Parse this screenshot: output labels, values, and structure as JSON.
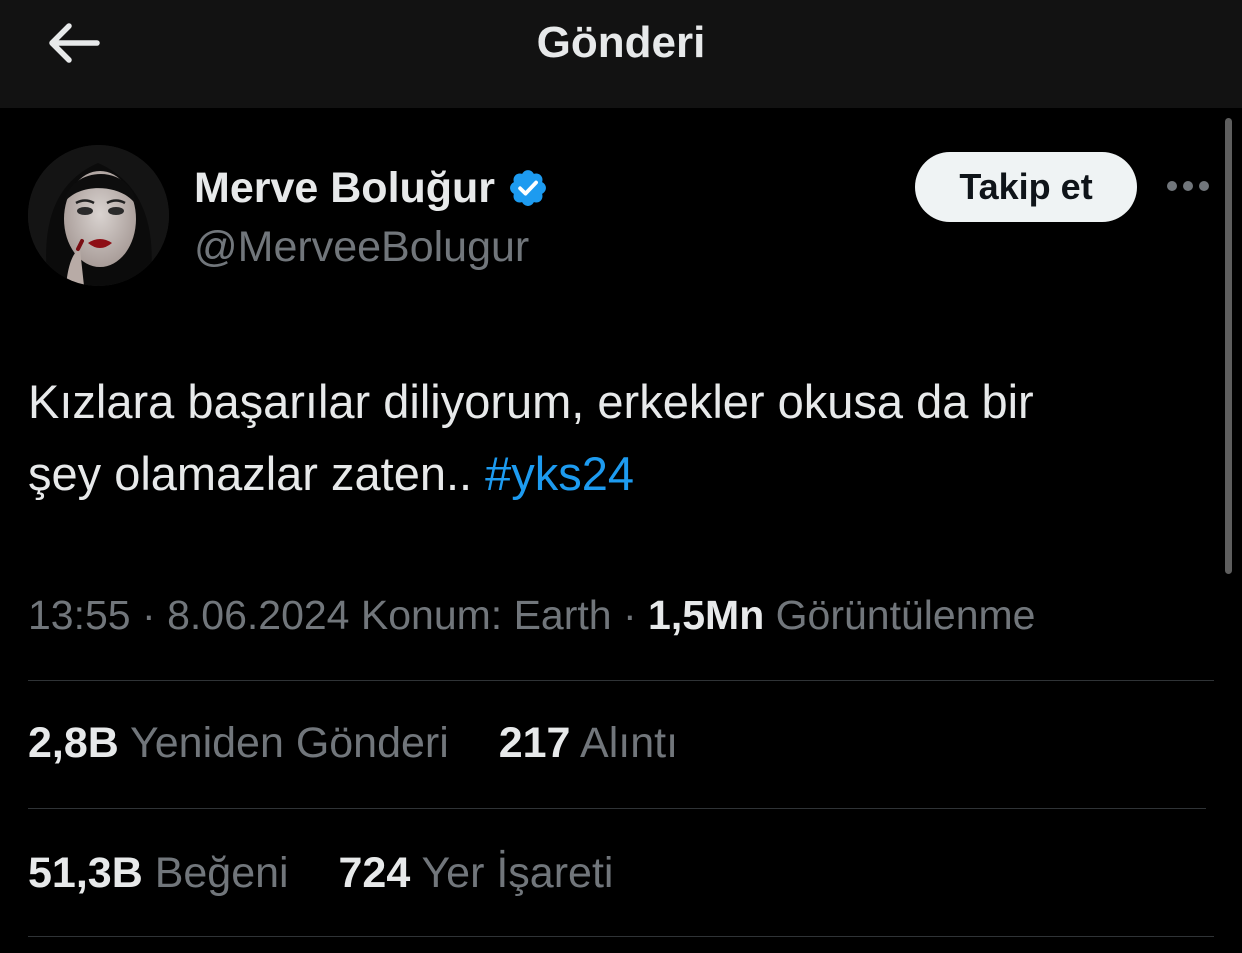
{
  "header": {
    "title": "Gönderi",
    "back_icon": "arrow-left-icon"
  },
  "author": {
    "display_name": "Merve Boluğur",
    "handle": "@MerveeBolugur",
    "verified_icon": "verified-badge-icon",
    "verified_color": "#1d9bf0"
  },
  "actions": {
    "follow_label": "Takip et",
    "more_icon": "more-horizontal-icon"
  },
  "tweet": {
    "text_line1": "Kızlara başarılar diliyorum, erkekler okusa da bir",
    "text_line2": "şey olamazlar zaten.. ",
    "hashtag": "#yks24"
  },
  "meta": {
    "time": "13:55",
    "separator": "·",
    "date": "8.06.2024",
    "location": "Konum: Earth",
    "views_count": "1,5Mn",
    "views_label": "Görüntülenme"
  },
  "stats": {
    "reposts_count": "2,8B",
    "reposts_label": "Yeniden Gönderi",
    "quotes_count": "217",
    "quotes_label": "Alıntı",
    "likes_count": "51,3B",
    "likes_label": "Beğeni",
    "bookmarks_count": "724",
    "bookmarks_label": "Yer İşareti"
  },
  "colors": {
    "background": "#000000",
    "header_background": "#121212",
    "text_primary": "#e7e9ea",
    "text_secondary": "#71767b",
    "accent": "#1d9bf0",
    "divider": "#2f3336"
  }
}
